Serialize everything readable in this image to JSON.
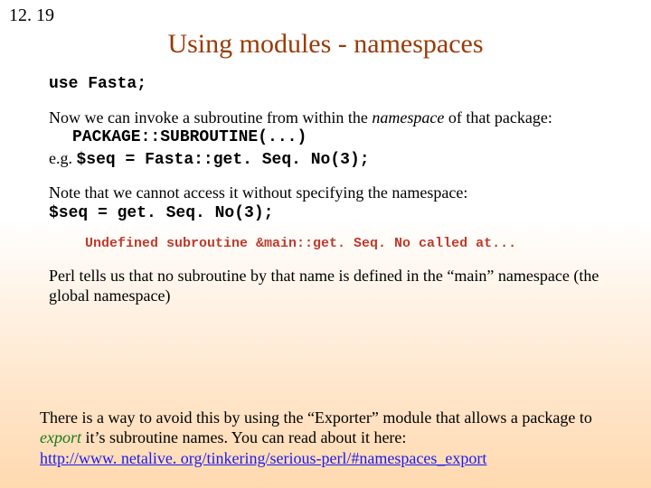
{
  "slide_number": "12. 19",
  "title": "Using modules - namespaces",
  "code_use": "use Fasta;",
  "para1_a": "Now we can invoke a subroutine from within the ",
  "para1_ns": "namespace",
  "para1_b": " of that package:",
  "code_pkg": "PACKAGE::SUBROUTINE(...)",
  "eg_label": "e.g. ",
  "code_eg": "$seq = Fasta::get. Seq. No(3);",
  "para2": "Note that we cannot access it without specifying the namespace:",
  "code_bad": "$seq = get. Seq. No(3);",
  "error_line": "Undefined subroutine &main::get. Seq. No called at...",
  "para3": "Perl tells us that no subroutine by that name is defined in the “main” namespace (the global namespace)",
  "bottom_a": "There is a way to avoid this by using the “Exporter” module that allows a package to ",
  "bottom_export": "export",
  "bottom_b": " it’s subroutine names.  You can read about it here:",
  "link_text": "http://www. netalive. org/tinkering/serious-perl/#namespaces_export"
}
